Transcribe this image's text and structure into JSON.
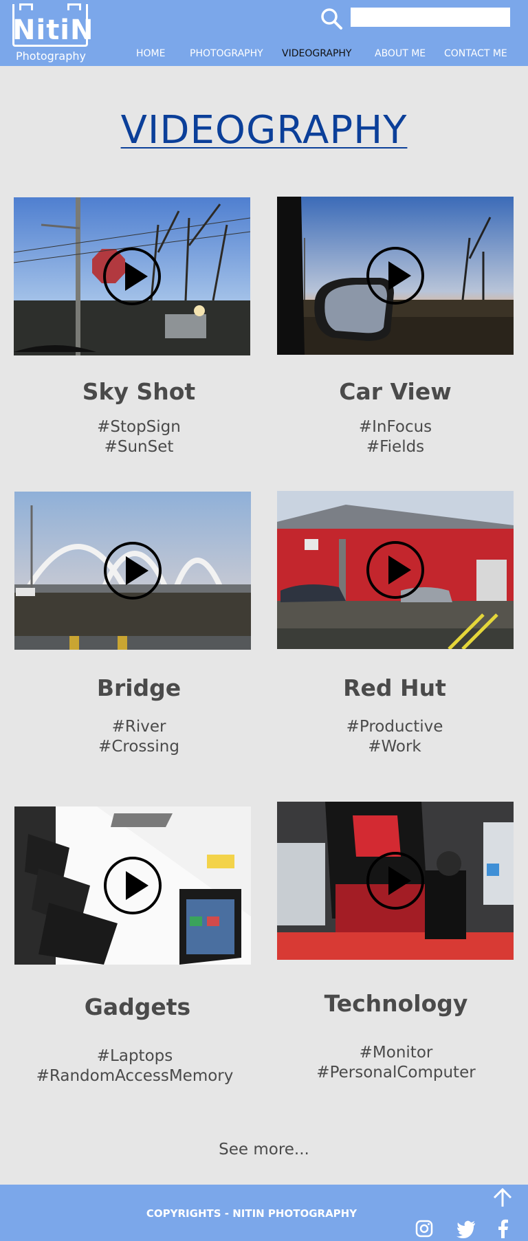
{
  "brand": {
    "name": "NitiN",
    "subtitle": "Photography"
  },
  "search": {
    "placeholder": ""
  },
  "nav": [
    {
      "label": "HOME"
    },
    {
      "label": "PHOTOGRAPHY"
    },
    {
      "label": "VIDEOGRAPHY",
      "active": true
    },
    {
      "label": "ABOUT ME"
    },
    {
      "label": "CONTACT ME"
    }
  ],
  "page": {
    "title": "VIDEOGRAPHY"
  },
  "videos": [
    {
      "title": "Sky Shot",
      "tags": [
        "#StopSign",
        "#SunSet"
      ]
    },
    {
      "title": "Car View",
      "tags": [
        "#InFocus",
        "#Fields"
      ]
    },
    {
      "title": "Bridge",
      "tags": [
        "#River",
        "#Crossing"
      ]
    },
    {
      "title": "Red Hut",
      "tags": [
        "#Productive",
        "#Work"
      ]
    },
    {
      "title": "Gadgets",
      "tags": [
        "#Laptops",
        "#RandomAccessMemory"
      ]
    },
    {
      "title": "Technology",
      "tags": [
        "#Monitor",
        "#PersonalComputer"
      ]
    }
  ],
  "see_more": "See more...",
  "footer": {
    "copyright": "COPYRIGHTS - NITIN PHOTOGRAPHY",
    "icons": [
      "arrow-up-icon",
      "instagram-icon",
      "twitter-icon",
      "facebook-icon"
    ]
  },
  "colors": {
    "header": "#7ba7ea",
    "background": "#e6e6e6",
    "title": "#0b3f99",
    "text": "#4a4a4a"
  }
}
